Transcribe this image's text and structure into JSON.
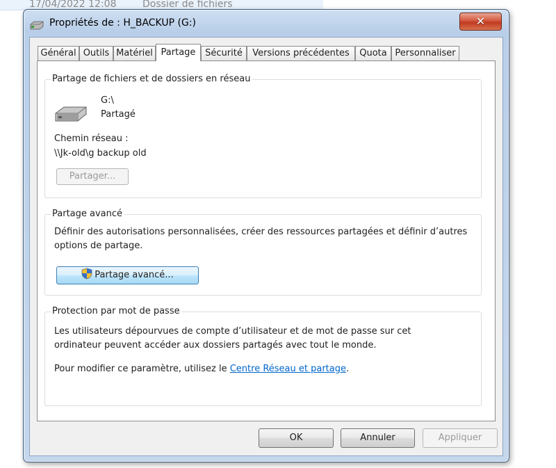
{
  "background": {
    "date": "17/04/2022 12:08",
    "type": "Dossier de fichiers"
  },
  "window": {
    "title": "Propriétés de : H_BACKUP (G:)",
    "close_label": "✕"
  },
  "tabs": [
    {
      "label": "Général"
    },
    {
      "label": "Outils"
    },
    {
      "label": "Matériel"
    },
    {
      "label": "Partage",
      "active": true
    },
    {
      "label": "Sécurité"
    },
    {
      "label": "Versions précédentes"
    },
    {
      "label": "Quota"
    },
    {
      "label": "Personnaliser"
    }
  ],
  "network_sharing": {
    "group_title": "Partage de fichiers et de dossiers en réseau",
    "drive_name": "G:\\",
    "status": "Partagé",
    "path_label": "Chemin réseau :",
    "path_value": "\\\\Jk-old\\g backup old",
    "share_button": "Partager..."
  },
  "advanced_sharing": {
    "group_title": "Partage avancé",
    "description_line1": "Définir des autorisations personnalisées, créer des ressources partagées et définir d’autres",
    "description_line2": "options de partage.",
    "button": "Partage avancé..."
  },
  "password_protection": {
    "group_title": "Protection par mot de passe",
    "line1": "Les utilisateurs dépourvues de compte d’utilisateur et de mot de passe sur cet",
    "line2": "ordinateur peuvent accéder aux dossiers partagés avec tout le monde.",
    "change_prefix": "Pour modifier ce paramètre, utilisez le ",
    "link_text": "Centre Réseau et partage",
    "change_suffix": "."
  },
  "buttons": {
    "ok": "OK",
    "cancel": "Annuler",
    "apply": "Appliquer"
  },
  "colors": {
    "link": "#0066cc",
    "close_button": "#c13b20",
    "window_frame": "#b9cfe9"
  }
}
